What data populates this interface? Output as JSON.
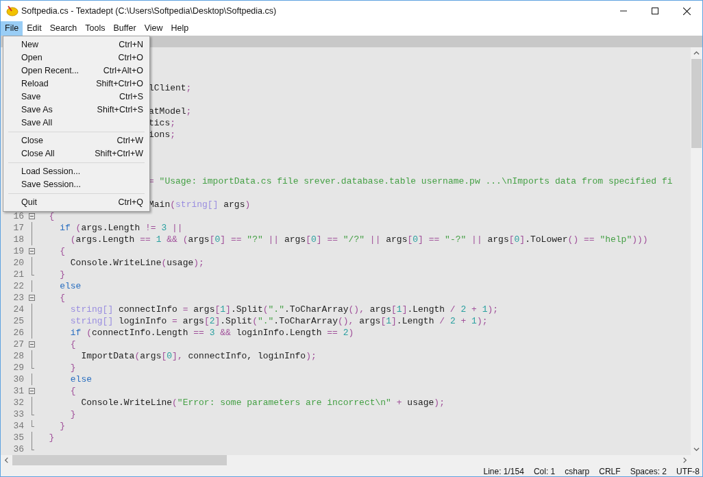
{
  "window": {
    "title": "Softpedia.cs - Textadept (C:\\Users\\Softpedia\\Desktop\\Softpedia.cs)"
  },
  "menu_bar": [
    {
      "label": "File",
      "selected": true
    },
    {
      "label": "Edit",
      "selected": false
    },
    {
      "label": "Search",
      "selected": false
    },
    {
      "label": "Tools",
      "selected": false
    },
    {
      "label": "Buffer",
      "selected": false
    },
    {
      "label": "View",
      "selected": false
    },
    {
      "label": "Help",
      "selected": false
    }
  ],
  "file_menu": {
    "groups": [
      [
        {
          "label": "New",
          "shortcut": "Ctrl+N"
        },
        {
          "label": "Open",
          "shortcut": "Ctrl+O"
        },
        {
          "label": "Open Recent...",
          "shortcut": "Ctrl+Alt+O"
        },
        {
          "label": "Reload",
          "shortcut": "Shift+Ctrl+O"
        },
        {
          "label": "Save",
          "shortcut": "Ctrl+S"
        },
        {
          "label": "Save As",
          "shortcut": "Shift+Ctrl+S"
        },
        {
          "label": "Save All"
        }
      ],
      [
        {
          "label": "Close",
          "shortcut": "Ctrl+W"
        },
        {
          "label": "Close All",
          "shortcut": "Shift+Ctrl+W"
        }
      ],
      [
        {
          "label": "Load Session..."
        },
        {
          "label": "Save Session..."
        }
      ],
      [
        {
          "label": "Quit",
          "shortcut": "Ctrl+Q"
        }
      ]
    ]
  },
  "editor": {
    "lines": [
      {
        "kind": "covered_blank"
      },
      {
        "kind": "covered_blank"
      },
      {
        "kind": "covered_blank"
      },
      {
        "kind": "covered",
        "tokens": [
          {
            "kind": "plain",
            "text": "lClient"
          },
          {
            "kind": "operator",
            "text": ";"
          }
        ]
      },
      {
        "kind": "covered_blank"
      },
      {
        "kind": "covered",
        "tokens": [
          {
            "kind": "plain",
            "text": "atModel"
          },
          {
            "kind": "operator",
            "text": ";"
          }
        ]
      },
      {
        "kind": "covered",
        "tokens": [
          {
            "kind": "plain",
            "text": "tics"
          },
          {
            "kind": "operator",
            "text": ";"
          }
        ]
      },
      {
        "kind": "covered",
        "tokens": [
          {
            "kind": "plain",
            "text": "ions"
          },
          {
            "kind": "operator",
            "text": ";"
          }
        ]
      },
      {
        "kind": "covered_blank"
      },
      {
        "kind": "covered_blank"
      },
      {
        "kind": "covered_blank"
      },
      {
        "kind": "covered",
        "tokens": [
          {
            "kind": "operator",
            "text": "= "
          },
          {
            "kind": "string",
            "text": "\"Usage: importData.cs file srever.database.table username.pw ...\\nImports data from specified fi"
          }
        ]
      },
      {
        "kind": "covered_blank"
      },
      {
        "kind": "covered",
        "tokens": [
          {
            "kind": "plain",
            "text": "Main"
          },
          {
            "kind": "operator",
            "text": "("
          },
          {
            "kind": "type",
            "text": "string[]"
          },
          {
            "kind": "plain",
            "text": " args"
          },
          {
            "kind": "operator",
            "text": ")"
          }
        ]
      },
      {
        "kind": "code",
        "number": "16",
        "fold_marker": {
          "kind": "start"
        },
        "tokens": [
          {
            "kind": "operator",
            "text": "  {"
          }
        ]
      },
      {
        "kind": "code",
        "number": "17",
        "fold_marker": {
          "kind": "line"
        },
        "tokens": [
          {
            "kind": "keyword",
            "text": "    if "
          },
          {
            "kind": "operator",
            "text": "("
          },
          {
            "kind": "plain",
            "text": "args.Length "
          },
          {
            "kind": "operator",
            "text": "!= "
          },
          {
            "kind": "number",
            "text": "3 "
          },
          {
            "kind": "operator",
            "text": "||"
          }
        ]
      },
      {
        "kind": "code",
        "number": "18",
        "fold_marker": {
          "kind": "line"
        },
        "tokens": [
          {
            "kind": "operator",
            "text": "      ("
          },
          {
            "kind": "plain",
            "text": "args.Length "
          },
          {
            "kind": "operator",
            "text": "== "
          },
          {
            "kind": "number",
            "text": "1 "
          },
          {
            "kind": "operator",
            "text": "&& ("
          },
          {
            "kind": "plain",
            "text": "args"
          },
          {
            "kind": "operator",
            "text": "["
          },
          {
            "kind": "number",
            "text": "0"
          },
          {
            "kind": "operator",
            "text": "] == "
          },
          {
            "kind": "string",
            "text": "\"?\" "
          },
          {
            "kind": "operator",
            "text": "|| "
          },
          {
            "kind": "plain",
            "text": "args"
          },
          {
            "kind": "operator",
            "text": "["
          },
          {
            "kind": "number",
            "text": "0"
          },
          {
            "kind": "operator",
            "text": "] == "
          },
          {
            "kind": "string",
            "text": "\"/?\" "
          },
          {
            "kind": "operator",
            "text": "|| "
          },
          {
            "kind": "plain",
            "text": "args"
          },
          {
            "kind": "operator",
            "text": "["
          },
          {
            "kind": "number",
            "text": "0"
          },
          {
            "kind": "operator",
            "text": "] == "
          },
          {
            "kind": "string",
            "text": "\"-?\" "
          },
          {
            "kind": "operator",
            "text": "|| "
          },
          {
            "kind": "plain",
            "text": "args"
          },
          {
            "kind": "operator",
            "text": "["
          },
          {
            "kind": "number",
            "text": "0"
          },
          {
            "kind": "operator",
            "text": "]"
          },
          {
            "kind": "plain",
            "text": ".ToLower"
          },
          {
            "kind": "operator",
            "text": "() == "
          },
          {
            "kind": "string",
            "text": "\"help\""
          },
          {
            "kind": "operator",
            "text": ")))"
          }
        ]
      },
      {
        "kind": "code",
        "number": "19",
        "fold_marker": {
          "kind": "start"
        },
        "tokens": [
          {
            "kind": "operator",
            "text": "    {"
          }
        ]
      },
      {
        "kind": "code",
        "number": "20",
        "fold_marker": {
          "kind": "line"
        },
        "tokens": [
          {
            "kind": "plain",
            "text": "      Console.WriteLine"
          },
          {
            "kind": "operator",
            "text": "("
          },
          {
            "kind": "plain",
            "text": "usage"
          },
          {
            "kind": "operator",
            "text": ");"
          }
        ]
      },
      {
        "kind": "code",
        "number": "21",
        "fold_marker": {
          "kind": "end"
        },
        "tokens": [
          {
            "kind": "operator",
            "text": "    }"
          }
        ]
      },
      {
        "kind": "code",
        "number": "22",
        "fold_marker": {
          "kind": "line"
        },
        "tokens": [
          {
            "kind": "keyword",
            "text": "    else"
          }
        ]
      },
      {
        "kind": "code",
        "number": "23",
        "fold_marker": {
          "kind": "start"
        },
        "tokens": [
          {
            "kind": "operator",
            "text": "    {"
          }
        ]
      },
      {
        "kind": "code",
        "number": "24",
        "fold_marker": {
          "kind": "line"
        },
        "tokens": [
          {
            "kind": "type",
            "text": "      string[]"
          },
          {
            "kind": "plain",
            "text": " connectInfo "
          },
          {
            "kind": "operator",
            "text": "= "
          },
          {
            "kind": "plain",
            "text": "args"
          },
          {
            "kind": "operator",
            "text": "["
          },
          {
            "kind": "number",
            "text": "1"
          },
          {
            "kind": "operator",
            "text": "]"
          },
          {
            "kind": "plain",
            "text": ".Split"
          },
          {
            "kind": "operator",
            "text": "("
          },
          {
            "kind": "string",
            "text": "\".\""
          },
          {
            "kind": "plain",
            "text": ".ToCharArray"
          },
          {
            "kind": "operator",
            "text": "(), "
          },
          {
            "kind": "plain",
            "text": "args"
          },
          {
            "kind": "operator",
            "text": "["
          },
          {
            "kind": "number",
            "text": "1"
          },
          {
            "kind": "operator",
            "text": "]"
          },
          {
            "kind": "plain",
            "text": ".Length "
          },
          {
            "kind": "operator",
            "text": "/ "
          },
          {
            "kind": "number",
            "text": "2 "
          },
          {
            "kind": "operator",
            "text": "+ "
          },
          {
            "kind": "number",
            "text": "1"
          },
          {
            "kind": "operator",
            "text": ");"
          }
        ]
      },
      {
        "kind": "code",
        "number": "25",
        "fold_marker": {
          "kind": "line"
        },
        "tokens": [
          {
            "kind": "type",
            "text": "      string[]"
          },
          {
            "kind": "plain",
            "text": " loginInfo "
          },
          {
            "kind": "operator",
            "text": "= "
          },
          {
            "kind": "plain",
            "text": "args"
          },
          {
            "kind": "operator",
            "text": "["
          },
          {
            "kind": "number",
            "text": "2"
          },
          {
            "kind": "operator",
            "text": "]"
          },
          {
            "kind": "plain",
            "text": ".Split"
          },
          {
            "kind": "operator",
            "text": "("
          },
          {
            "kind": "string",
            "text": "\".\""
          },
          {
            "kind": "plain",
            "text": ".ToCharArray"
          },
          {
            "kind": "operator",
            "text": "(), "
          },
          {
            "kind": "plain",
            "text": "args"
          },
          {
            "kind": "operator",
            "text": "["
          },
          {
            "kind": "number",
            "text": "1"
          },
          {
            "kind": "operator",
            "text": "]"
          },
          {
            "kind": "plain",
            "text": ".Length "
          },
          {
            "kind": "operator",
            "text": "/ "
          },
          {
            "kind": "number",
            "text": "2 "
          },
          {
            "kind": "operator",
            "text": "+ "
          },
          {
            "kind": "number",
            "text": "1"
          },
          {
            "kind": "operator",
            "text": ");"
          }
        ]
      },
      {
        "kind": "code",
        "number": "26",
        "fold_marker": {
          "kind": "line"
        },
        "tokens": [
          {
            "kind": "keyword",
            "text": "      if "
          },
          {
            "kind": "operator",
            "text": "("
          },
          {
            "kind": "plain",
            "text": "connectInfo.Length "
          },
          {
            "kind": "operator",
            "text": "== "
          },
          {
            "kind": "number",
            "text": "3 "
          },
          {
            "kind": "operator",
            "text": "&& "
          },
          {
            "kind": "plain",
            "text": "loginInfo.Length "
          },
          {
            "kind": "operator",
            "text": "== "
          },
          {
            "kind": "number",
            "text": "2"
          },
          {
            "kind": "operator",
            "text": ")"
          }
        ]
      },
      {
        "kind": "code",
        "number": "27",
        "fold_marker": {
          "kind": "start"
        },
        "tokens": [
          {
            "kind": "operator",
            "text": "      {"
          }
        ]
      },
      {
        "kind": "code",
        "number": "28",
        "fold_marker": {
          "kind": "line"
        },
        "tokens": [
          {
            "kind": "plain",
            "text": "        ImportData"
          },
          {
            "kind": "operator",
            "text": "("
          },
          {
            "kind": "plain",
            "text": "args"
          },
          {
            "kind": "operator",
            "text": "["
          },
          {
            "kind": "number",
            "text": "0"
          },
          {
            "kind": "operator",
            "text": "],"
          },
          {
            "kind": "plain",
            "text": " connectInfo, loginInfo"
          },
          {
            "kind": "operator",
            "text": ");"
          }
        ]
      },
      {
        "kind": "code",
        "number": "29",
        "fold_marker": {
          "kind": "end"
        },
        "tokens": [
          {
            "kind": "operator",
            "text": "      }"
          }
        ]
      },
      {
        "kind": "code",
        "number": "30",
        "fold_marker": {
          "kind": "line"
        },
        "tokens": [
          {
            "kind": "keyword",
            "text": "      else"
          }
        ]
      },
      {
        "kind": "code",
        "number": "31",
        "fold_marker": {
          "kind": "start"
        },
        "tokens": [
          {
            "kind": "operator",
            "text": "      {"
          }
        ]
      },
      {
        "kind": "code",
        "number": "32",
        "fold_marker": {
          "kind": "line"
        },
        "tokens": [
          {
            "kind": "plain",
            "text": "        Console.WriteLine"
          },
          {
            "kind": "operator",
            "text": "("
          },
          {
            "kind": "string",
            "text": "\"Error: some parameters are incorrect\\n\" "
          },
          {
            "kind": "operator",
            "text": "+ "
          },
          {
            "kind": "plain",
            "text": "usage"
          },
          {
            "kind": "operator",
            "text": ");"
          }
        ]
      },
      {
        "kind": "code",
        "number": "33",
        "fold_marker": {
          "kind": "end"
        },
        "tokens": [
          {
            "kind": "operator",
            "text": "      }"
          }
        ]
      },
      {
        "kind": "code",
        "number": "34",
        "fold_marker": {
          "kind": "end"
        },
        "tokens": [
          {
            "kind": "operator",
            "text": "    }"
          }
        ]
      },
      {
        "kind": "code",
        "number": "35",
        "fold_marker": {
          "kind": "line"
        },
        "tokens": [
          {
            "kind": "operator",
            "text": "  }"
          }
        ]
      },
      {
        "kind": "code",
        "number": "36",
        "fold_marker": {
          "kind": "end"
        }
      }
    ]
  },
  "status_bar": [
    "Line: 1/154",
    "Col: 1",
    "csharp",
    "CRLF",
    "Spaces: 2",
    "UTF-8"
  ]
}
